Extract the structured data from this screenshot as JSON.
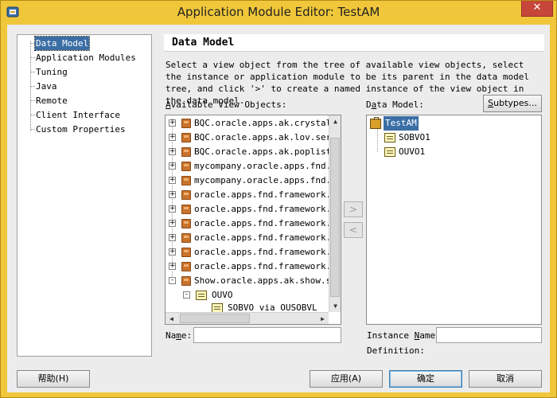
{
  "window": {
    "title": "Application Module Editor: TestAM",
    "close_glyph": "✕",
    "accent": "#f0c73a",
    "close_color": "#c7463a"
  },
  "nav": {
    "items": [
      {
        "label": "Data Model",
        "selected": true
      },
      {
        "label": "Application Modules"
      },
      {
        "label": "Tuning"
      },
      {
        "label": "Java"
      },
      {
        "label": "Remote"
      },
      {
        "label": "Client Interface"
      },
      {
        "label": "Custom Properties"
      }
    ]
  },
  "section": {
    "title": "Data Model",
    "description": "Select a view object from the tree of available view objects, select the instance or application module to be its parent in the data model tree, and click '>' to create a named instance of the view object in the data model."
  },
  "available": {
    "label_pre": "",
    "label_key": "A",
    "label_post": "vailable View Objects:",
    "rows": [
      {
        "text": "BQC.oracle.apps.ak.crystal.s",
        "icon": "package-icon",
        "expander": "+"
      },
      {
        "text": "BQC.oracle.apps.ak.lov.serve",
        "icon": "package-icon",
        "expander": "+"
      },
      {
        "text": "BQC.oracle.apps.ak.poplist.s",
        "icon": "package-icon",
        "expander": "+"
      },
      {
        "text": "mycompany.oracle.apps.fnd.fr",
        "icon": "package-icon",
        "expander": "+"
      },
      {
        "text": "mycompany.oracle.apps.fnd.fr",
        "icon": "package-icon",
        "expander": "+"
      },
      {
        "text": "oracle.apps.fnd.framework.to",
        "icon": "package-icon",
        "expander": "+"
      },
      {
        "text": "oracle.apps.fnd.framework.to",
        "icon": "package-icon",
        "expander": "+"
      },
      {
        "text": "oracle.apps.fnd.framework.to",
        "icon": "package-icon",
        "expander": "+"
      },
      {
        "text": "oracle.apps.fnd.framework.to",
        "icon": "package-icon",
        "expander": "+"
      },
      {
        "text": "oracle.apps.fnd.framework.to",
        "icon": "package-icon",
        "expander": "+"
      },
      {
        "text": "oracle.apps.fnd.framework.to",
        "icon": "package-icon",
        "expander": "+"
      },
      {
        "text": "Show.oracle.apps.ak.show.ser",
        "icon": "package-icon",
        "expander": "-"
      },
      {
        "text": "OUVO",
        "icon": "view-object-icon",
        "expander": "-"
      },
      {
        "text": "SOBVO via OUSOBVL",
        "icon": "view-object-icon",
        "expander": ""
      }
    ]
  },
  "shuttle": {
    "add_glyph": ">",
    "remove_glyph": "<"
  },
  "data_model": {
    "label_pre": "D",
    "label_key": "a",
    "label_post": "ta Model:",
    "subtypes_pre": "",
    "subtypes_key": "S",
    "subtypes_post": "ubtypes...",
    "rows": [
      {
        "text": "TestAM",
        "icon": "app-module-icon",
        "selected": true
      },
      {
        "text": "SOBVO1",
        "icon": "view-object-icon"
      },
      {
        "text": "OUVO1",
        "icon": "view-object-icon"
      }
    ]
  },
  "fields": {
    "name_pre": "Na",
    "name_key": "m",
    "name_post": "e:",
    "name_value": "",
    "instance_pre": "Instance ",
    "instance_key": "N",
    "instance_post": "ame:",
    "instance_value": "",
    "definition_label": "Definition:"
  },
  "buttons": {
    "help": "帮助(H)",
    "apply": "应用(A)",
    "ok": "确定",
    "cancel": "取消"
  }
}
